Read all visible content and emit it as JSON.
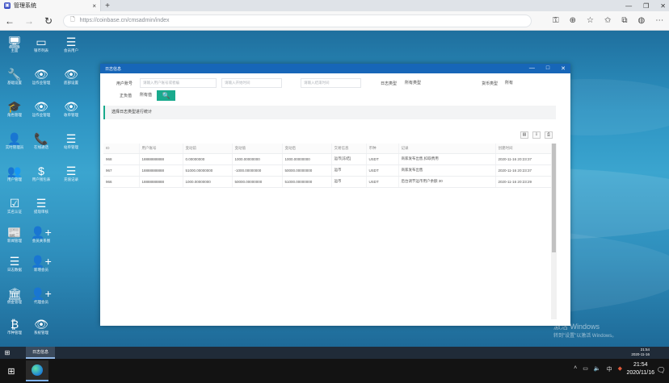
{
  "browser": {
    "tab_title": "管理系统",
    "tab_icon_glyph": "▣",
    "url": "https://coinbase.cn/cmsadmin/index"
  },
  "desktop": {
    "icons": [
      {
        "label": "主面",
        "glyph": "🖥"
      },
      {
        "label": "银币列表",
        "glyph": "▭"
      },
      {
        "label": "会员用户",
        "glyph": "☰"
      },
      {
        "label": "基础设置",
        "glyph": "🔧"
      },
      {
        "label": "运作业管理",
        "glyph": "👁"
      },
      {
        "label": "底部设置",
        "glyph": "👁"
      },
      {
        "label": "角色管理",
        "glyph": "🎓"
      },
      {
        "label": "运作业管理",
        "glyph": "👁"
      },
      {
        "label": "收单管理",
        "glyph": "👁"
      },
      {
        "label": "实时管理员",
        "glyph": "👤"
      },
      {
        "label": "在线通话",
        "glyph": "📞"
      },
      {
        "label": "站单管理",
        "glyph": "☰"
      },
      {
        "label": "用户管理",
        "glyph": "👥"
      },
      {
        "label": "用户钱包表",
        "glyph": "$"
      },
      {
        "label": "充值记录",
        "glyph": "☰"
      },
      {
        "label": "实名认证",
        "glyph": "☑"
      },
      {
        "label": "提现审核",
        "glyph": "☰"
      },
      {
        "label": "新闻管理",
        "glyph": "📰"
      },
      {
        "label": "会员关系图",
        "glyph": "👤+"
      },
      {
        "label": "日志数据",
        "glyph": "☰"
      },
      {
        "label": "新增会员",
        "glyph": "👤+"
      },
      {
        "label": "佣金管理",
        "glyph": "🏛"
      },
      {
        "label": "代理会员",
        "glyph": "👤+"
      },
      {
        "label": "币种管理",
        "glyph": "₿"
      },
      {
        "label": "系统管理",
        "glyph": "👁"
      }
    ],
    "watermark_line1": "激活 Windows",
    "watermark_line2": "转到\"设置\"以激活 Windows。"
  },
  "appwin": {
    "title": "日志信息",
    "filters": {
      "user_account_label": "用户账号",
      "user_account_placeholder": "请输入用户账号或者编",
      "start_time_placeholder": "请输入开始时间",
      "end_time_placeholder": "请输入结束时间",
      "log_type_label": "日志类型",
      "log_type_value": "所有类型",
      "currency_type_label": "货币类型",
      "currency_type_value": "所有",
      "type_label": "正负值",
      "type_value": "所有值",
      "search_glyph": "🔍"
    },
    "notice": "选择日志类型进行统计",
    "tools": [
      "▤",
      "⇩",
      "⎙"
    ],
    "table": {
      "headers": [
        "ID",
        "用户账号",
        "变动前",
        "变动值",
        "变动后",
        "交易信息",
        "币种",
        "记录",
        "创建时间"
      ],
      "rows": [
        [
          "968",
          "18888888888",
          "0.00000000",
          "1000.00000000",
          "1000.00000000",
          "运币[冻结]",
          "USDT",
          "商家发布出售,扣取费用",
          "2020-11-16 20:23:37"
        ],
        [
          "967",
          "18888888888",
          "51000.00000000",
          "-1000.00000000",
          "50000.00000000",
          "运币",
          "USDT",
          "商家发布出售",
          "2020-11-16 20:23:37"
        ],
        [
          "966",
          "18888888888",
          "1000.00000000",
          "50000.00000000",
          "51000.00000000",
          "运币",
          "USDT",
          "后台调节运币用户余额 30",
          "2020-11-16 20:23:29"
        ]
      ]
    }
  },
  "taskbar_inner": {
    "app_label": "日志信息",
    "time": "21:54",
    "date": "2020-11-16"
  },
  "taskbar_outer": {
    "tray_ime": "中",
    "time": "21:54",
    "date": "2020/11/16"
  }
}
